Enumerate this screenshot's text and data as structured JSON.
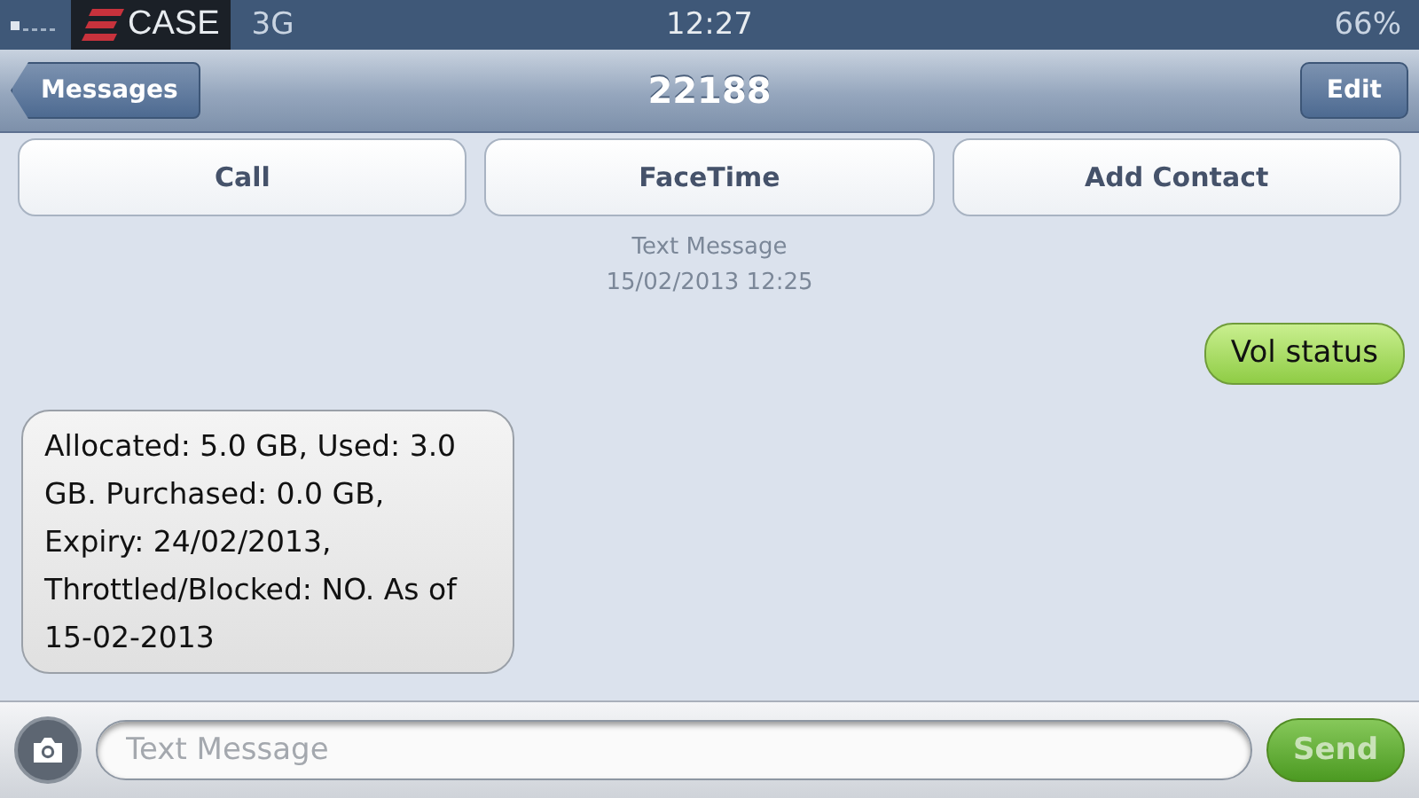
{
  "status_bar": {
    "carrier": "CASE",
    "network": "3G",
    "time": "12:27",
    "battery": "66%"
  },
  "nav": {
    "back": "Messages",
    "title": "22188",
    "edit": "Edit"
  },
  "actions": [
    "Call",
    "FaceTime",
    "Add Contact"
  ],
  "timestamp": {
    "label": "Text Message",
    "date": "15/02/2013 12:25"
  },
  "messages": [
    {
      "kind": "sent",
      "text": "Vol status"
    },
    {
      "kind": "received",
      "text": "Allocated: 5.0 GB, Used: 3.0 GB. Purchased: 0.0 GB, Expiry: 24/02/2013, Throttled/Blocked: NO. As of 15-02-2013"
    }
  ],
  "composer": {
    "placeholder": "Text Message",
    "send": "Send",
    "send_disabled": true
  }
}
